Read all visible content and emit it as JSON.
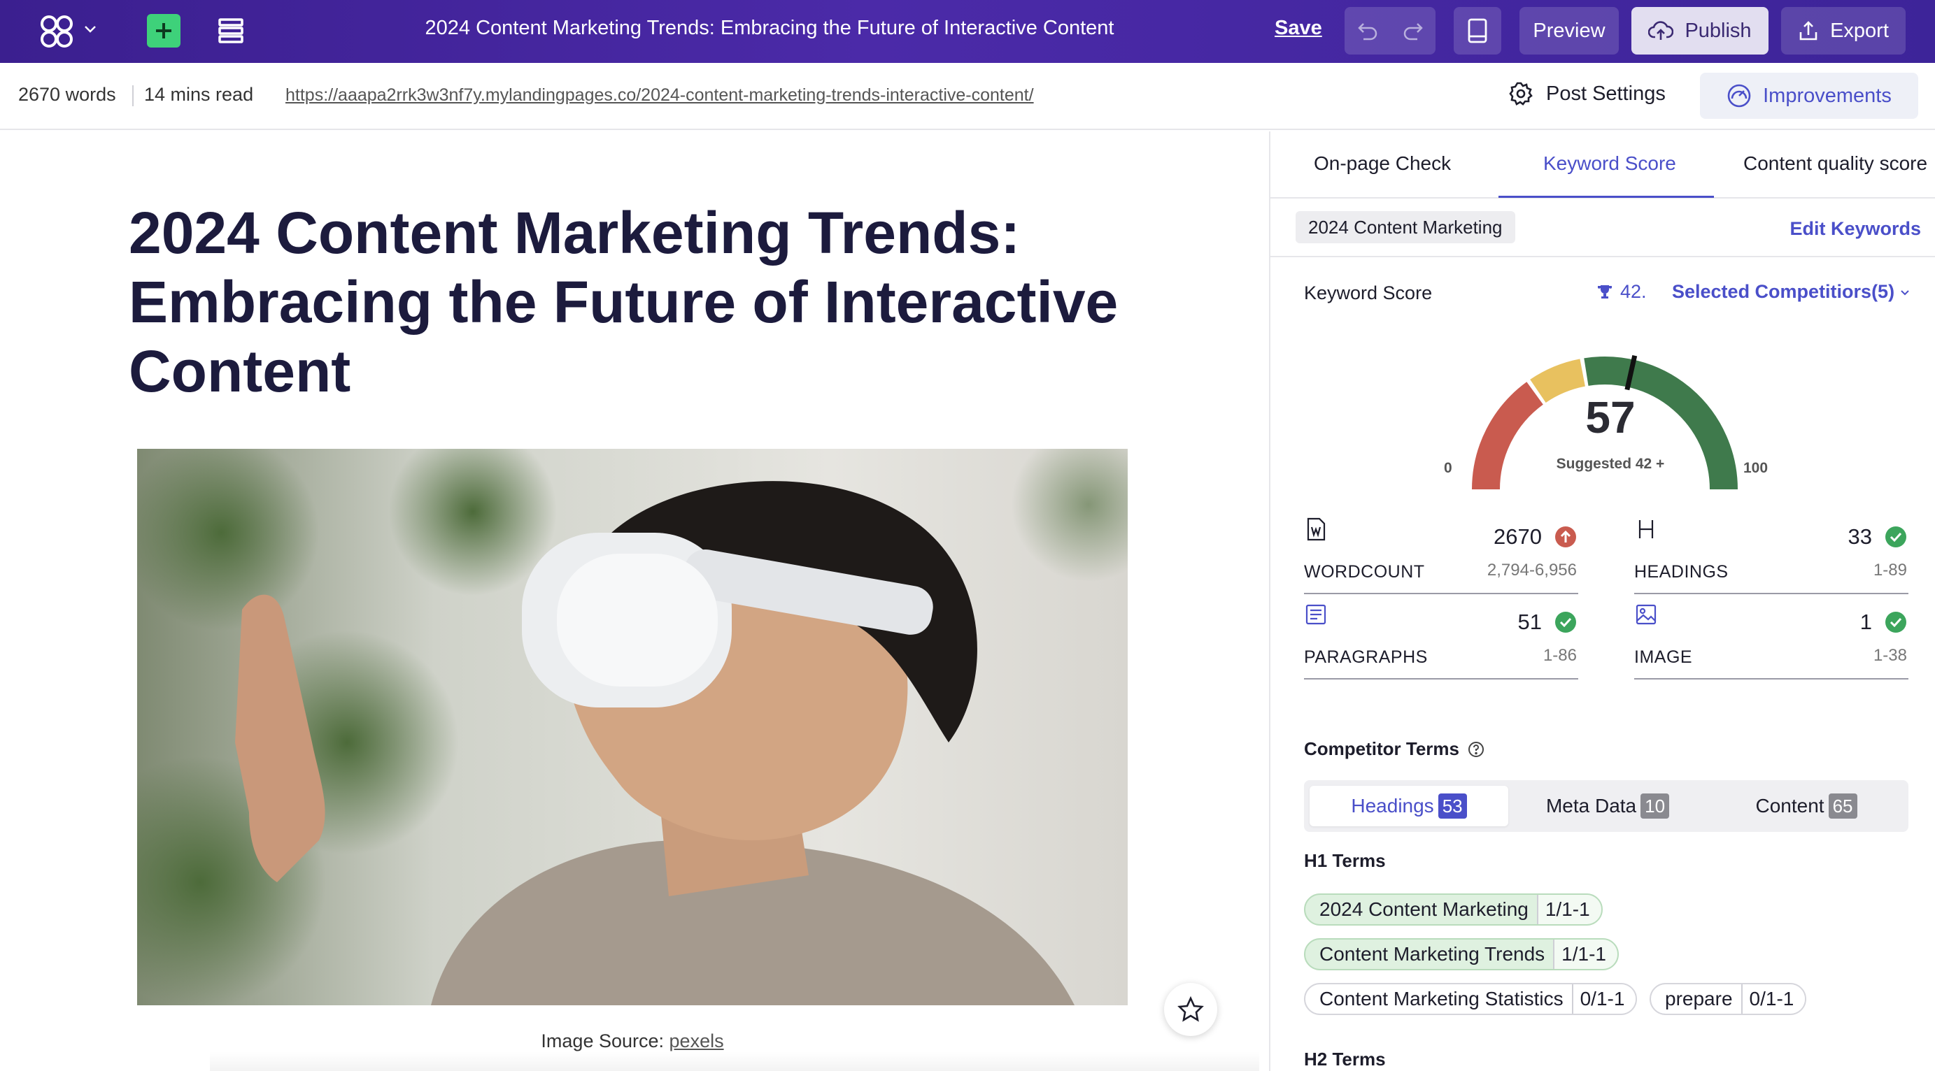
{
  "topbar": {
    "title": "2024 Content Marketing Trends: Embracing the Future of Interactive Content",
    "save_label": "Save",
    "preview_label": "Preview",
    "publish_label": "Publish",
    "export_label": "Export",
    "icons": [
      "logo-icon",
      "chevron-down-icon",
      "plus-icon",
      "layers-icon",
      "undo-icon",
      "redo-icon",
      "tablet-icon",
      "cloud-upload-icon",
      "export-icon"
    ],
    "colors": {
      "bar": "#3b1f8f",
      "add": "#3ed17a"
    }
  },
  "subbar": {
    "words": "2670 words",
    "read_time": "14 mins read",
    "url": "https://aaapa2rrk3w3nf7y.mylandingpages.co/2024-content-marketing-trends-interactive-content/",
    "post_settings_label": "Post Settings",
    "improvements_label": "Improvements"
  },
  "editor": {
    "headline": "2024 Content Marketing Trends: Embracing the Future of Interactive Content",
    "caption_prefix": "Image Source:",
    "caption_link": "pexels"
  },
  "panel": {
    "tabs": [
      "On-page Check",
      "Keyword Score",
      "Content quality score"
    ],
    "active_tab": "Keyword Score",
    "keyword_chip": "2024 Content Marketing",
    "edit_keywords_label": "Edit Keywords",
    "keyword_score_label": "Keyword Score",
    "trophy_value": "42.",
    "competitors_label": "Selected Competitiors(5)",
    "gauge": {
      "score": "57",
      "suggested": "Suggested 42 +",
      "min_label": "0",
      "max_label": "100",
      "score_value": 57,
      "colors": {
        "low": "#c95b4f",
        "mid": "#e8c15f",
        "high": "#3f7a4c"
      }
    },
    "metrics": {
      "wordcount": {
        "label": "WORDCOUNT",
        "value": "2670",
        "range": "2,794-6,956",
        "status": "below"
      },
      "headings": {
        "label": "HEADINGS",
        "value": "33",
        "range": "1-89",
        "status": "ok"
      },
      "paragraphs": {
        "label": "PARAGRAPHS",
        "value": "51",
        "range": "1-86",
        "status": "ok"
      },
      "image": {
        "label": "IMAGE",
        "value": "1",
        "range": "1-38",
        "status": "ok"
      }
    },
    "competitor_terms_label": "Competitor Terms",
    "segments": [
      {
        "label": "Headings",
        "count": "53"
      },
      {
        "label": "Meta Data",
        "count": "10"
      },
      {
        "label": "Content",
        "count": "65"
      }
    ],
    "h1_label": "H1 Terms",
    "h1_terms": [
      {
        "name": "2024 Content Marketing",
        "count": "1/1-1",
        "hit": true
      },
      {
        "name": "Content Marketing Trends",
        "count": "1/1-1",
        "hit": true
      },
      {
        "name": "Content Marketing Statistics",
        "count": "0/1-1",
        "hit": false
      },
      {
        "name": "prepare",
        "count": "0/1-1",
        "hit": false
      }
    ],
    "h2_label": "H2 Terms"
  }
}
